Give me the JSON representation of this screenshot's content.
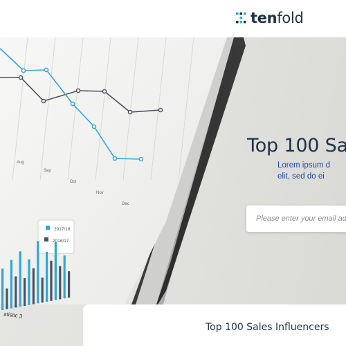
{
  "brand": {
    "name_bold": "ten",
    "name_rest": "fold",
    "logo_icon": "tenfold-dots-icon",
    "colors": {
      "navy": "#1f3147",
      "accent": "#2ea7d8",
      "link": "#1f4aa0"
    }
  },
  "hero": {
    "headline": "Top 100 Sa",
    "subtext_line1": "Lorem ipsum d",
    "subtext_line2": "elit, sed do ei",
    "email_placeholder": "Please enter your email add"
  },
  "photo_chart": {
    "months": [
      "Aug",
      "Sep",
      "Oct",
      "Nov",
      "Dec"
    ],
    "legend": [
      "2017/18",
      "2016/17"
    ],
    "caption": "atistic 3"
  },
  "card": {
    "title": "Top 100 Sales Influencers"
  }
}
